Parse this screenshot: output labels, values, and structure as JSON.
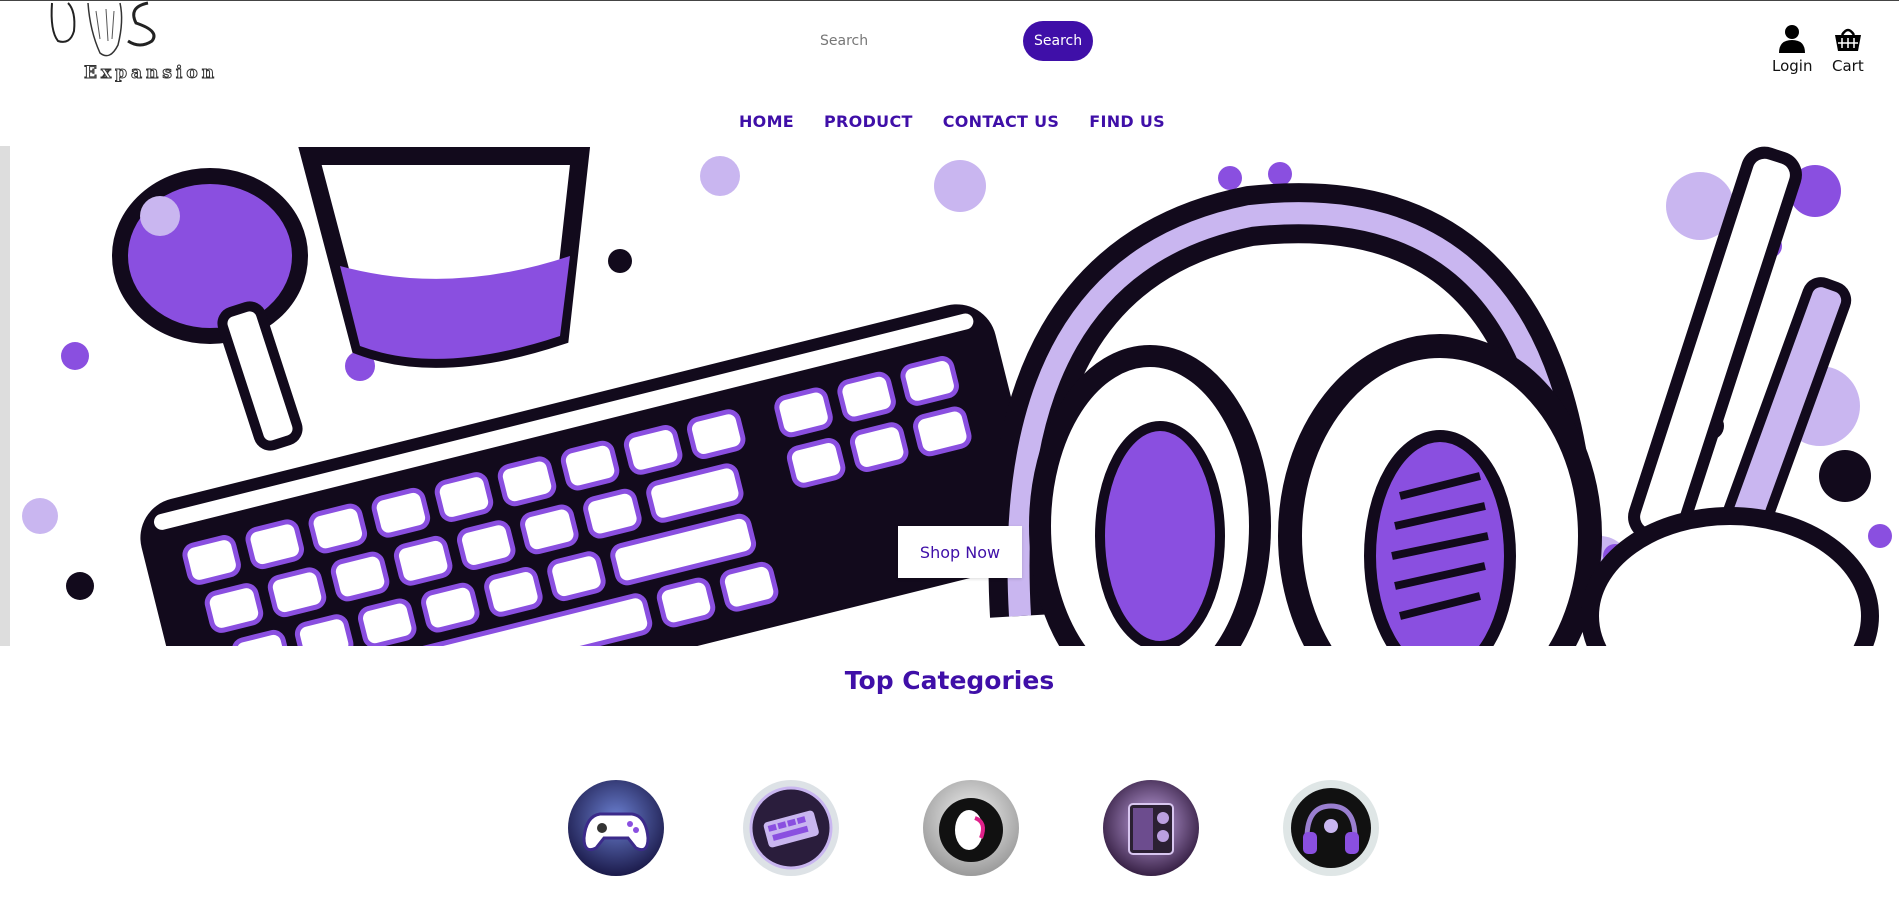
{
  "brand": {
    "logo_text": "Expansion"
  },
  "search": {
    "placeholder": "Search",
    "button_label": "Search"
  },
  "account": {
    "login_label": "Login",
    "cart_label": "Cart"
  },
  "nav": {
    "items": [
      {
        "label": "HOME"
      },
      {
        "label": "PRODUCT"
      },
      {
        "label": "CONTACT US"
      },
      {
        "label": "FIND US"
      }
    ]
  },
  "hero": {
    "cta_label": "Shop Now"
  },
  "categories": {
    "title": "Top Categories",
    "items": [
      {
        "icon": "controller-icon"
      },
      {
        "icon": "keyboard-icon"
      },
      {
        "icon": "mouse-icon"
      },
      {
        "icon": "pc-case-icon"
      },
      {
        "icon": "headphones-icon"
      }
    ]
  },
  "colors": {
    "accent": "#3f0fa8",
    "purple": "#8a4fe0",
    "light_purple": "#c9b6f0",
    "dark": "#120a1c"
  }
}
